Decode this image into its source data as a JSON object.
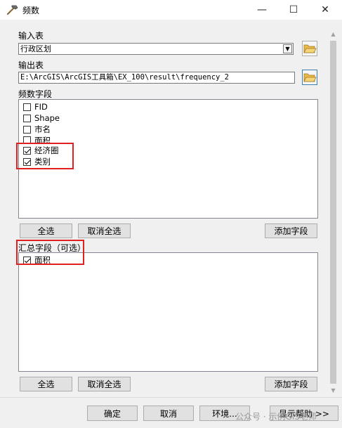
{
  "window": {
    "title": "频数",
    "minimize_glyph": "—",
    "maximize_glyph": "☐",
    "close_glyph": "✕"
  },
  "input_table": {
    "label": "输入表",
    "value": "行政区划"
  },
  "output_table": {
    "label": "输出表",
    "value": "E:\\ArcGIS\\ArcGIS工具箱\\EX_100\\result\\frequency_2"
  },
  "frequency_fields": {
    "label": "频数字段",
    "items": [
      {
        "label": "FID",
        "checked": false
      },
      {
        "label": "Shape",
        "checked": false
      },
      {
        "label": "市名",
        "checked": false
      },
      {
        "label": "面积",
        "checked": false
      },
      {
        "label": "经济圈",
        "checked": true
      },
      {
        "label": "类别",
        "checked": true
      }
    ],
    "select_all": "全选",
    "clear_all": "取消全选",
    "add_field": "添加字段"
  },
  "summary_fields": {
    "label": "汇总字段（可选）",
    "items": [
      {
        "label": "面积",
        "checked": true
      }
    ],
    "select_all": "全选",
    "clear_all": "取消全选",
    "add_field": "添加字段"
  },
  "footer": {
    "ok": "确定",
    "cancel": "取消",
    "env": "环境...",
    "help": "显示帮助 >>"
  },
  "watermark": "公众号 · 示例GIS老师",
  "colors": {
    "highlight_border": "#e02020",
    "window_bg": "#f0f0f0"
  },
  "icons": {
    "title": "hammer-icon",
    "folder": "open-folder-icon"
  }
}
